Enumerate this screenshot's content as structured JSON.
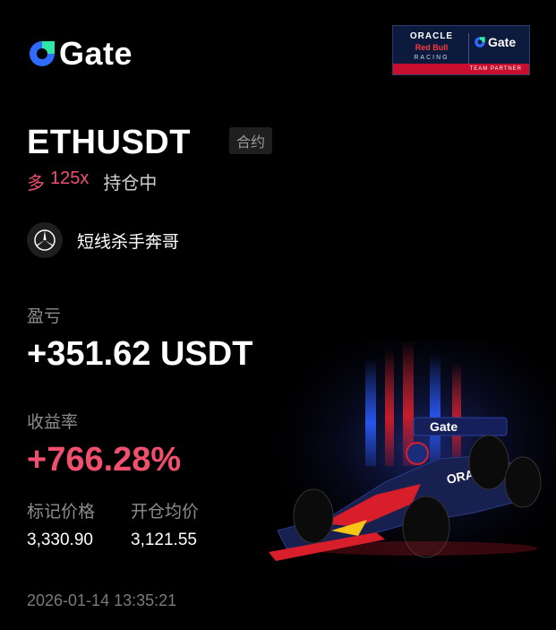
{
  "brand": {
    "name": "Gate"
  },
  "partner": {
    "oracle": "ORACLE",
    "redbull": "Red Bull",
    "racing": "RACING",
    "gate": "Gate",
    "tagline": "TEAM PARTNER"
  },
  "position": {
    "symbol": "ETHUSDT",
    "contract_tag": "合约",
    "side": "多",
    "leverage": "125x",
    "status": "持仓中"
  },
  "user": {
    "name": "短线杀手奔哥"
  },
  "pnl": {
    "label": "盈亏",
    "value": "+351.62 USDT"
  },
  "roi": {
    "label": "收益率",
    "value": "+766.28%"
  },
  "prices": {
    "mark_label": "标记价格",
    "mark_value": "3,330.90",
    "entry_label": "开仓均价",
    "entry_value": "3,121.55"
  },
  "timestamp": "2026-01-14 13:35:21",
  "colors": {
    "background": "#000000",
    "accent_red": "#f0506e",
    "brand_blue": "#2f6bff",
    "brand_green": "#2ee6a6"
  }
}
